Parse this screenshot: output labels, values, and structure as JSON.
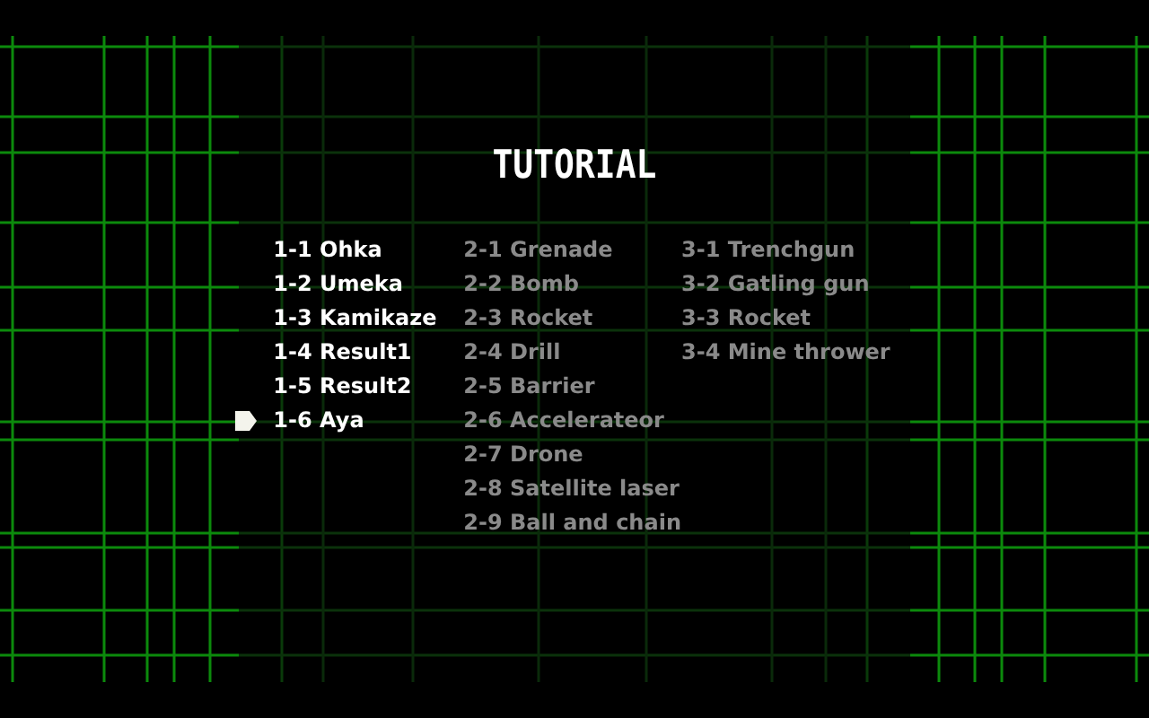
{
  "title": "TUTORIAL",
  "columns": [
    {
      "items": [
        {
          "label": "1-1 Ohka",
          "unlocked": true,
          "selected": false
        },
        {
          "label": "1-2 Umeka",
          "unlocked": true,
          "selected": false
        },
        {
          "label": "1-3 Kamikaze",
          "unlocked": true,
          "selected": false
        },
        {
          "label": "1-4 Result1",
          "unlocked": true,
          "selected": false
        },
        {
          "label": "1-5 Result2",
          "unlocked": true,
          "selected": false
        },
        {
          "label": "1-6 Aya",
          "unlocked": true,
          "selected": true
        }
      ]
    },
    {
      "items": [
        {
          "label": "2-1 Grenade",
          "unlocked": false,
          "selected": false
        },
        {
          "label": "2-2 Bomb",
          "unlocked": false,
          "selected": false
        },
        {
          "label": "2-3 Rocket",
          "unlocked": false,
          "selected": false
        },
        {
          "label": "2-4 Drill",
          "unlocked": false,
          "selected": false
        },
        {
          "label": "2-5 Barrier",
          "unlocked": false,
          "selected": false
        },
        {
          "label": "2-6 Accelerateor",
          "unlocked": false,
          "selected": false
        },
        {
          "label": "2-7 Drone",
          "unlocked": false,
          "selected": false
        },
        {
          "label": "2-8 Satellite laser",
          "unlocked": false,
          "selected": false
        },
        {
          "label": "2-9 Ball and chain",
          "unlocked": false,
          "selected": false
        }
      ]
    },
    {
      "items": [
        {
          "label": "3-1 Trenchgun",
          "unlocked": false,
          "selected": false
        },
        {
          "label": "3-2 Gatling gun",
          "unlocked": false,
          "selected": false
        },
        {
          "label": "3-3 Rocket",
          "unlocked": false,
          "selected": false
        },
        {
          "label": "3-4 Mine thrower",
          "unlocked": false,
          "selected": false
        }
      ]
    }
  ]
}
